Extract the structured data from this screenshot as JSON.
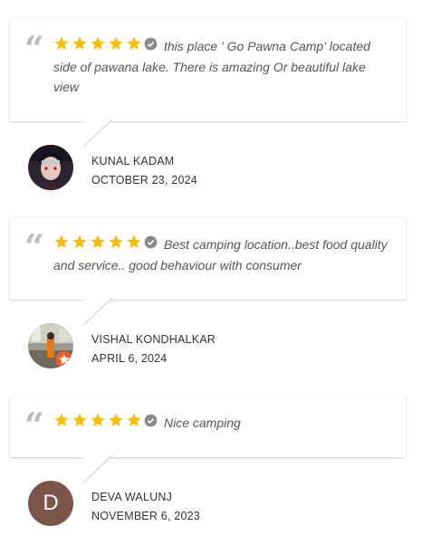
{
  "reviews": [
    {
      "text": "this place ' Go Pawna Camp' located side of pawana lake. There is amazing Or beautiful lake view",
      "rating": 5,
      "name": "KUNAL KADAM",
      "date": "OCTOBER 23, 2024",
      "avatar": "photo-avatar"
    },
    {
      "text": "Best camping location..best food quality and service.. good behaviour with consumer",
      "rating": 5,
      "name": "VISHAL KONDHALKAR",
      "date": "APRIL 6, 2024",
      "avatar": "photo-avatar"
    },
    {
      "text": "Nice camping",
      "rating": 5,
      "name": "DEVA WALUNJ",
      "date": "NOVEMBER 6, 2023",
      "avatar": "D"
    }
  ],
  "colors": {
    "star": "#fbbc04",
    "quote": "#bdbdbd",
    "verified": "#8a8a8a",
    "initial_avatar_bg": "#7a5548"
  }
}
